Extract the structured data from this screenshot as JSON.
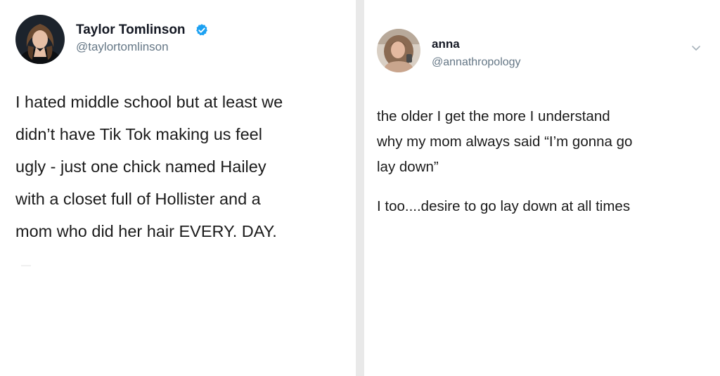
{
  "left_tweet": {
    "author": {
      "name": "Taylor Tomlinson",
      "handle": "@taylortomlinson",
      "verified_icon": "verified-badge-icon"
    },
    "lines": [
      "I hated middle school but at least we",
      "didn’t have Tik Tok making us feel",
      "ugly - just one chick named Hailey",
      "with a closet full of Hollister and a",
      "mom who did her hair EVERY. DAY."
    ]
  },
  "right_tweet": {
    "author": {
      "name": "anna",
      "handle": "@annathropology"
    },
    "menu_icon": "chevron-down-icon",
    "paragraph_1_lines": [
      "the older I get the more I understand",
      "why my mom always said “I’m gonna go",
      "lay down”"
    ],
    "paragraph_2": "I too....desire to go lay down at all times"
  },
  "colors": {
    "background": "#ffffff",
    "divider": "#e9e9e9",
    "name_text": "#141823",
    "handle_text": "#657786",
    "body_text": "#1b1b1b",
    "verified_blue": "#1da1f2"
  }
}
